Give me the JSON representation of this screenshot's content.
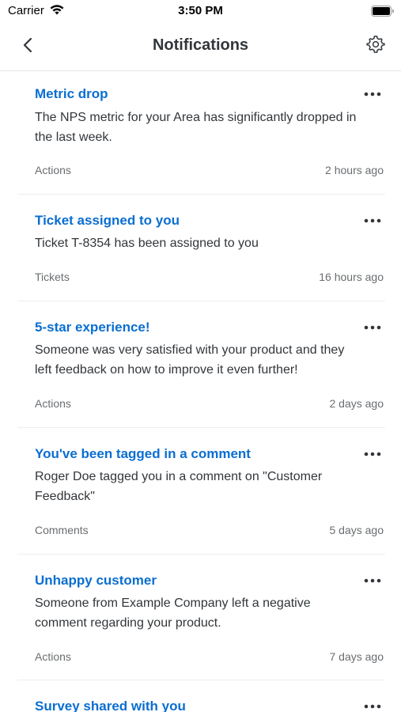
{
  "status_bar": {
    "carrier": "Carrier",
    "time": "3:50 PM"
  },
  "header": {
    "title": "Notifications",
    "back_icon": "chevron-left-icon",
    "settings_icon": "gear-icon"
  },
  "colors": {
    "accent": "#0a6ed1",
    "text": "#32363a",
    "secondary": "#6a6d70"
  },
  "notifications": [
    {
      "title": "Metric drop",
      "body": "The NPS metric for your Area has significantly dropped in the last week.",
      "category": "Actions",
      "time": "2 hours ago"
    },
    {
      "title": "Ticket assigned to you",
      "body": "Ticket T-8354 has been assigned to you",
      "category": "Tickets",
      "time": "16 hours ago"
    },
    {
      "title": "5-star experience!",
      "body": "Someone was very satisfied with your product and they left feedback on how to improve it even further!",
      "category": "Actions",
      "time": "2 days ago"
    },
    {
      "title": "You've been tagged in a comment",
      "body": "Roger Doe tagged you in a comment on \"Customer Feedback\"",
      "category": "Comments",
      "time": "5 days ago"
    },
    {
      "title": "Unhappy customer",
      "body": "Someone from Example Company left a negative comment regarding your product.",
      "category": "Actions",
      "time": "7 days ago"
    },
    {
      "title": "Survey shared with you",
      "body": "",
      "category": "",
      "time": ""
    }
  ]
}
